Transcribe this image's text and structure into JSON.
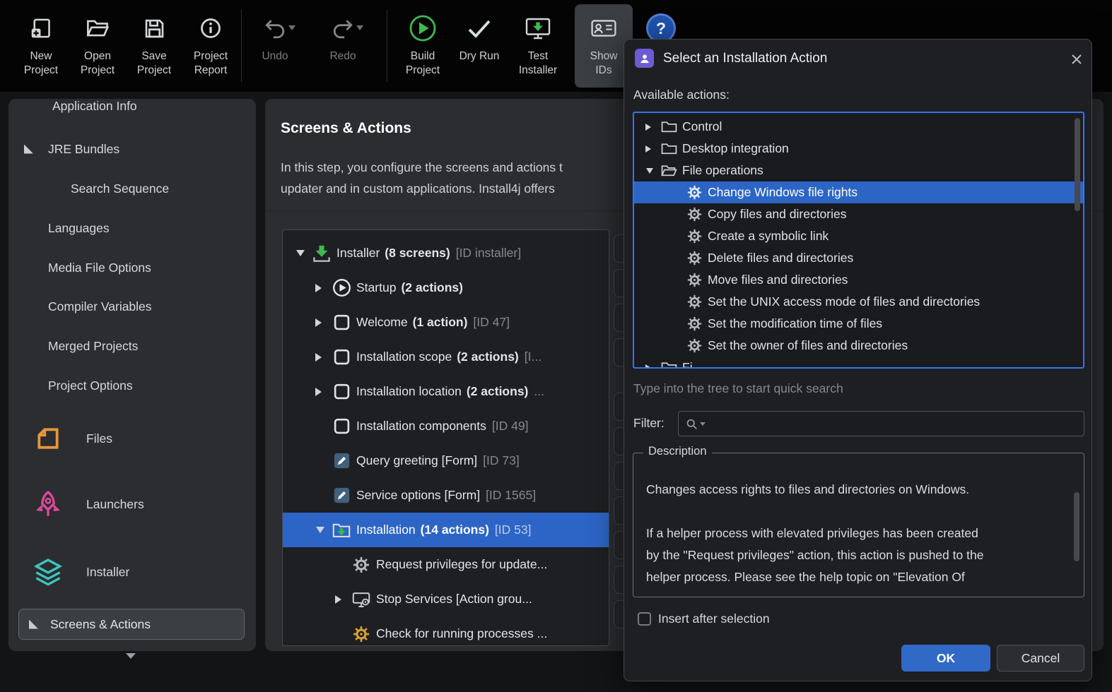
{
  "colors": {
    "accent": "#3574f0",
    "selection": "#2d65c6",
    "build_green": "#3fb950",
    "files_orange": "#e8963c",
    "launchers_pink": "#e2489d",
    "installer_teal": "#3ec6c0",
    "panel_bg": "#2b2d30",
    "dialog_bg": "#1e1f22"
  },
  "toolbar": {
    "items": [
      {
        "label": "New Project"
      },
      {
        "label": "Open Project"
      },
      {
        "label": "Save Project"
      },
      {
        "label": "Project Report"
      },
      {
        "label": "Undo",
        "disabled": true
      },
      {
        "label": "Redo",
        "disabled": true
      },
      {
        "label": "Build Project"
      },
      {
        "label": "Dry Run"
      },
      {
        "label": "Test Installer"
      },
      {
        "label": "Show IDs",
        "active": true
      }
    ]
  },
  "sidebar": {
    "items": [
      {
        "label": "Application Info"
      },
      {
        "label": "JRE Bundles",
        "marker": true
      },
      {
        "label": "Search Sequence",
        "indent": 2
      },
      {
        "label": "Languages"
      },
      {
        "label": "Media File Options"
      },
      {
        "label": "Compiler Variables"
      },
      {
        "label": "Merged Projects"
      },
      {
        "label": "Project Options"
      },
      {
        "label": "Files",
        "icon": "files-icon"
      },
      {
        "label": "Launchers",
        "icon": "rocket-icon"
      },
      {
        "label": "Installer",
        "icon": "layers-icon"
      },
      {
        "label": "Screens & Actions",
        "marker": true,
        "selected": true
      }
    ]
  },
  "main": {
    "title": "Screens & Actions",
    "intro_line1": "In this step, you configure the screens and actions t",
    "intro_line2": "updater and in custom applications. Install4j offers",
    "tree": {
      "items": [
        {
          "name": "Installer",
          "bold": "(8 screens)",
          "id": "[ID installer]",
          "icon": "installer",
          "indent": 0,
          "expander": "expanded",
          "selected": false
        },
        {
          "name": "Startup",
          "bold": "(2 actions)",
          "id": "",
          "icon": "startup",
          "indent": 1,
          "expander": "collapsed",
          "selected": false
        },
        {
          "name": "Welcome",
          "bold": "(1 action)",
          "id": "[ID 47]",
          "icon": "screen",
          "indent": 1,
          "expander": "collapsed",
          "selected": false
        },
        {
          "name": "Installation scope",
          "bold": "(2 actions)",
          "id": "[I...",
          "icon": "screen",
          "indent": 1,
          "expander": "collapsed",
          "selected": false
        },
        {
          "name": "Installation location",
          "bold": "(2 actions)",
          "id": "...",
          "icon": "screen",
          "indent": 1,
          "expander": "collapsed",
          "selected": false
        },
        {
          "name": "Installation components",
          "bold": "",
          "id": "[ID 49]",
          "icon": "screen",
          "indent": 1,
          "expander": "none",
          "selected": false
        },
        {
          "name": "Query greeting [Form]",
          "bold": "",
          "id": "[ID 73]",
          "icon": "form",
          "indent": 1,
          "expander": "none",
          "selected": false
        },
        {
          "name": "Service options [Form]",
          "bold": "",
          "id": "[ID 1565]",
          "icon": "form",
          "indent": 1,
          "expander": "none",
          "selected": false
        },
        {
          "name": "Installation",
          "bold": "(14 actions)",
          "id": "[ID 53]",
          "icon": "folder-install",
          "indent": 1,
          "expander": "expanded",
          "selected": true
        },
        {
          "name": "Request privileges for update...",
          "bold": "",
          "id": "",
          "icon": "gear",
          "indent": 2,
          "expander": "none",
          "selected": false
        },
        {
          "name": "Stop Services [Action grou...",
          "bold": "",
          "id": "",
          "icon": "action-group",
          "indent": 2,
          "expander": "collapsed",
          "selected": false
        },
        {
          "name": "Check for running processes ...",
          "bold": "",
          "id": "",
          "icon": "gear-orange",
          "indent": 2,
          "expander": "none",
          "selected": false
        }
      ]
    }
  },
  "dialog": {
    "title": "Select an Installation Action",
    "available_label": "Available actions:",
    "tree": {
      "items": [
        {
          "label": "Control",
          "icon": "folder",
          "indent": 0,
          "expander": "collapsed",
          "selected": false
        },
        {
          "label": "Desktop integration",
          "icon": "folder",
          "indent": 0,
          "expander": "collapsed",
          "selected": false
        },
        {
          "label": "File operations",
          "icon": "folder-open",
          "indent": 0,
          "expander": "expanded",
          "selected": false
        },
        {
          "label": "Change Windows file rights",
          "icon": "gear",
          "indent": 1,
          "expander": "none",
          "selected": true
        },
        {
          "label": "Copy files and directories",
          "icon": "gear",
          "indent": 1,
          "expander": "none",
          "selected": false
        },
        {
          "label": "Create a symbolic link",
          "icon": "gear",
          "indent": 1,
          "expander": "none",
          "selected": false
        },
        {
          "label": "Delete files and directories",
          "icon": "gear",
          "indent": 1,
          "expander": "none",
          "selected": false
        },
        {
          "label": "Move files and directories",
          "icon": "gear",
          "indent": 1,
          "expander": "none",
          "selected": false
        },
        {
          "label": "Set the UNIX access mode of files and directories",
          "icon": "gear",
          "indent": 1,
          "expander": "none",
          "selected": false
        },
        {
          "label": "Set the modification time of files",
          "icon": "gear",
          "indent": 1,
          "expander": "none",
          "selected": false
        },
        {
          "label": "Set the owner of files and directories",
          "icon": "gear",
          "indent": 1,
          "expander": "none",
          "selected": false
        },
        {
          "label": "Fi",
          "icon": "folder",
          "indent": 0,
          "expander": "collapsed",
          "selected": false,
          "partial": true
        }
      ]
    },
    "hint": "Type into the tree to start quick search",
    "filter_label": "Filter:",
    "filter_value": "",
    "description": {
      "title": "Description",
      "lines": [
        "Changes access rights to files and directories on Windows.",
        "",
        "If a helper process with elevated privileges has been created",
        "by the \"Request privileges\" action, this action is pushed to the",
        "helper process. Please see the help topic on \"Elevation Of"
      ]
    },
    "checkbox": {
      "label": "Insert after selection",
      "checked": false
    },
    "buttons": {
      "ok": "OK",
      "cancel": "Cancel"
    }
  }
}
